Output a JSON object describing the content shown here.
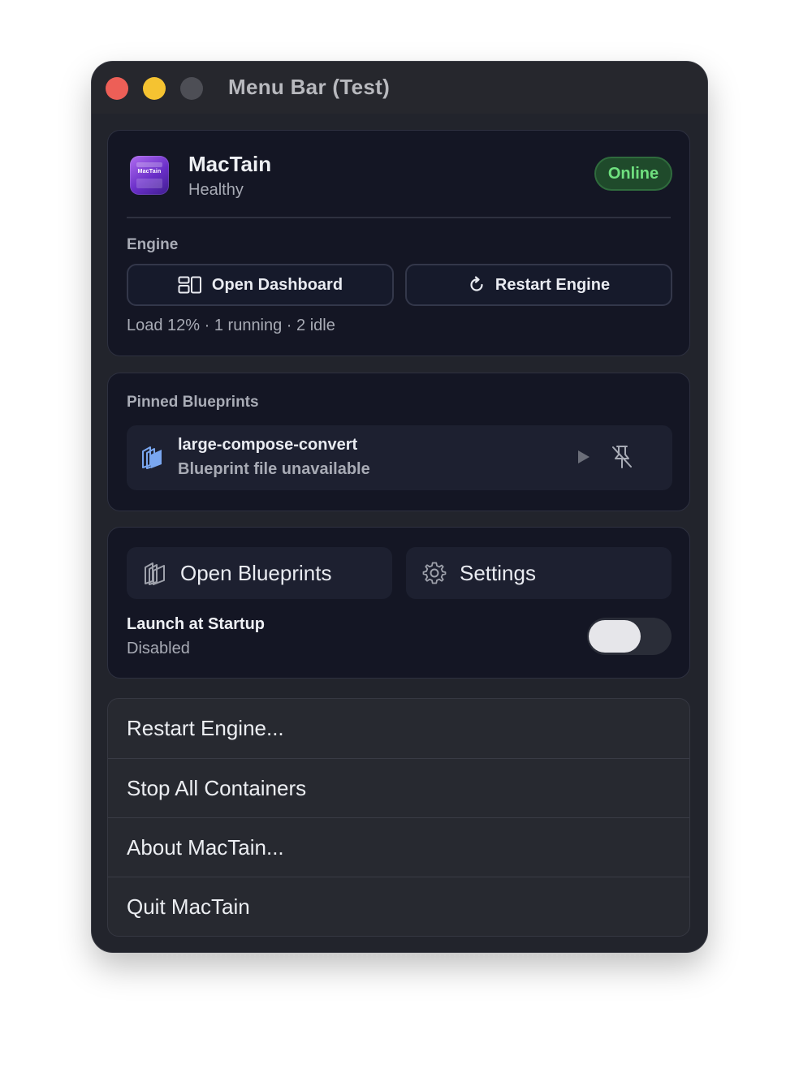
{
  "window": {
    "title": "Menu Bar (Test)"
  },
  "app": {
    "name": "MacTain",
    "health": "Healthy",
    "status_badge": "Online",
    "icon_text": "MacTain",
    "badge_color": "#6fe07f"
  },
  "engine": {
    "section_label": "Engine",
    "open_dashboard_label": "Open Dashboard",
    "restart_engine_label": "Restart Engine",
    "load_summary": "Load 12% · 1 running · 2 idle"
  },
  "pinned": {
    "section_label": "Pinned Blueprints",
    "items": [
      {
        "name": "large-compose-convert",
        "subtitle": "Blueprint file unavailable"
      }
    ]
  },
  "actions": {
    "open_blueprints_label": "Open Blueprints",
    "settings_label": "Settings",
    "launch_title": "Launch at Startup",
    "launch_status": "Disabled",
    "launch_enabled": false
  },
  "menu": {
    "items": [
      {
        "label": "Restart Engine..."
      },
      {
        "label": "Stop All Containers"
      },
      {
        "label": "About MacTain..."
      },
      {
        "label": "Quit MacTain"
      }
    ]
  }
}
